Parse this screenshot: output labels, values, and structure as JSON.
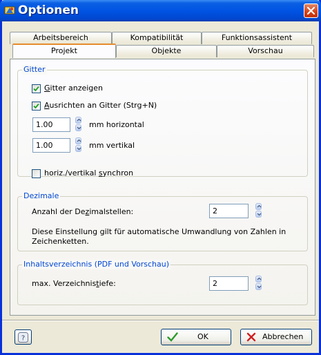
{
  "window": {
    "title": "Optionen"
  },
  "tabs_back": [
    {
      "label": "Arbeitsbereich"
    },
    {
      "label": "Kompatibilität"
    },
    {
      "label": "Funktionsassistent"
    }
  ],
  "tabs_front": [
    {
      "label": "Projekt",
      "active": true
    },
    {
      "label": "Objekte",
      "active": false
    },
    {
      "label": "Vorschau",
      "active": false
    }
  ],
  "gitter": {
    "title": "Gitter",
    "show_grid": {
      "prefix": "",
      "mnemonic": "G",
      "rest": "itter anzeigen",
      "checked": true
    },
    "snap_grid": {
      "prefix": "",
      "mnemonic": "A",
      "rest": "usrichten an Gitter (Strg+N)",
      "checked": true
    },
    "horizontal": {
      "value": "1.00",
      "label": "mm horizontal"
    },
    "vertical": {
      "value": "1.00",
      "label": "mm vertikal"
    },
    "sync": {
      "prefix": "horiz./vertikal ",
      "mnemonic": "s",
      "rest": "ynchron",
      "checked": false
    }
  },
  "dezimale": {
    "title": "Dezimale",
    "label_prefix": "Anzahl der De",
    "label_mnemonic": "z",
    "label_rest": "imalstellen:",
    "value": "2",
    "info": "Diese Einstellung gilt für automatische Umwandlung von Zahlen in Zeichenketten."
  },
  "toc": {
    "title": "Inhaltsverzeichnis (PDF und Vorschau)",
    "label_prefix": "max. Verzeichnis",
    "label_mnemonic": "t",
    "label_rest": "iefe:",
    "value": "2"
  },
  "buttons": {
    "ok": "OK",
    "cancel": "Abbrechen"
  },
  "colors": {
    "titlebar": "#0054e3",
    "group_title": "#0046d5",
    "tab_highlight": "#e68b2c",
    "ok_icon": "#2a9a2a",
    "cancel_icon": "#d02020"
  },
  "icons": {
    "app": "app-logo-icon",
    "close": "close-icon",
    "help": "help-icon",
    "ok": "checkmark-icon",
    "cancel": "cross-icon"
  }
}
